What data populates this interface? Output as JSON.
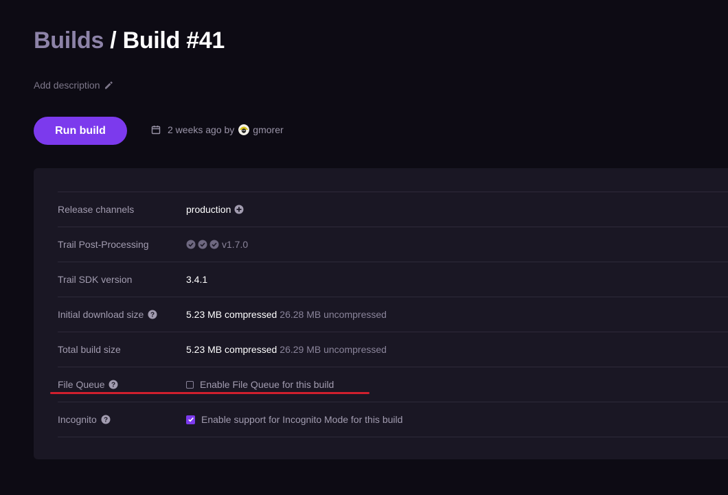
{
  "header": {
    "breadcrumb_root": "Builds",
    "separator": "/",
    "build_title": "Build #41",
    "add_description": "Add description"
  },
  "actions": {
    "run_build_label": "Run build"
  },
  "meta": {
    "time": "2 weeks ago by",
    "user": "gmorer"
  },
  "details": {
    "release_channels": {
      "label": "Release channels",
      "value": "production"
    },
    "post_processing": {
      "label": "Trail Post-Processing",
      "version": "v1.7.0"
    },
    "sdk_version": {
      "label": "Trail SDK version",
      "value": "3.4.1"
    },
    "initial_download": {
      "label": "Initial download size",
      "compressed": "5.23 MB compressed",
      "uncompressed": "26.28 MB uncompressed"
    },
    "total_build": {
      "label": "Total build size",
      "compressed": "5.23 MB compressed",
      "uncompressed": "26.29 MB uncompressed"
    },
    "file_queue": {
      "label": "File Queue",
      "option": "Enable File Queue for this build",
      "checked": false
    },
    "incognito": {
      "label": "Incognito",
      "option": "Enable support for Incognito Mode for this build",
      "checked": true
    }
  },
  "colors": {
    "background": "#0d0b14",
    "panel": "#1a1724",
    "accent": "#7c3aed",
    "annotation": "#d01f2e"
  }
}
